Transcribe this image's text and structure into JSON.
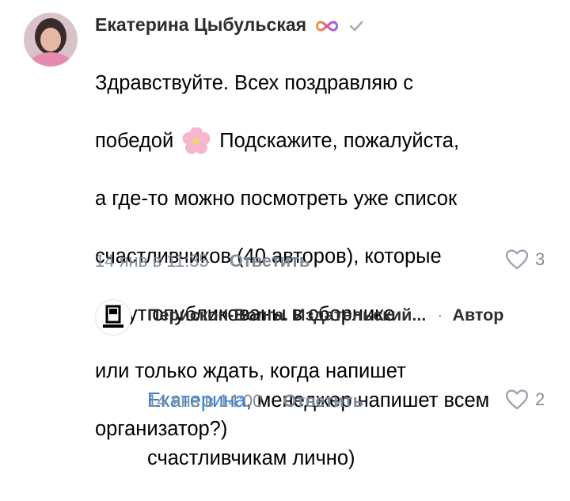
{
  "comment": {
    "author": "Екатерина Цыбульская",
    "lines": [
      "Здравствуйте. Всех поздравляю с",
      "победой",
      "Подскажите, пожалуйста,",
      "а где-то можно посмотреть уже список",
      "счастливчиков (40 авторов), которые",
      "будут опубликованы в сборнике",
      "или только ждать, когда напишет",
      "организатор?)"
    ],
    "timestamp": "14 янв в 11:35",
    "reply_label": "Ответить",
    "likes": "3"
  },
  "reply": {
    "author": "Перископ-Волга. Издательский...",
    "author_tag": "Автор",
    "mention": "Екатерина",
    "text_after_mention": ", менеджер напишет всем",
    "text_line2": "счастливчикам лично)",
    "timestamp": "14 янв в 14:00",
    "reply_label": "Ответить",
    "likes": "2"
  },
  "icons": {
    "infinity": "infinity-badge-icon",
    "verified": "checkmark-icon",
    "flower": "flower-emoji-icon",
    "heart": "heart-outline-icon"
  },
  "colors": {
    "infinity_start": "#f0a030",
    "infinity_end": "#9b5de5",
    "secondary": "#818c99",
    "link": "#2d81e0"
  }
}
